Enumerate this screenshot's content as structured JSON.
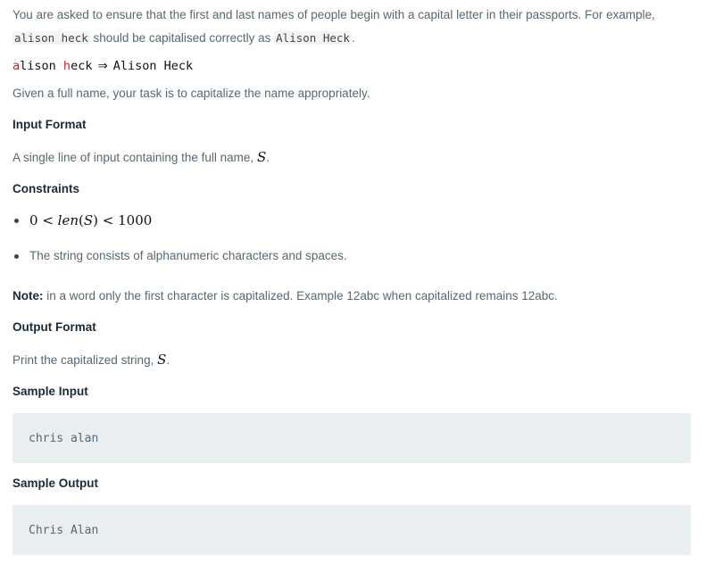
{
  "intro": {
    "part1": "You are asked to ensure that the first and last names of people begin with a capital letter in their passports. For example, ",
    "code1": "alison heck",
    "part2": " should be capitalised correctly as ",
    "code2": "Alison Heck",
    "part3": "."
  },
  "example": {
    "first_letter_1": "a",
    "rest_1": "lison ",
    "first_letter_2": "h",
    "rest_2": "eck",
    "arrow": "⇒",
    "result": "Alison Heck"
  },
  "given": "Given a full name, your task is to capitalize the name appropriately.",
  "input_format": {
    "heading": "Input Format",
    "text": "A single line of input containing the full name, ",
    "var": "S",
    "end": "."
  },
  "constraints": {
    "heading": "Constraints",
    "bullet1": {
      "zero": "0",
      "lt1": " < ",
      "fn": "len",
      "open": "(",
      "var": "S",
      "close": ")",
      "lt2": " < ",
      "max": "1000"
    },
    "bullet2": "The string consists of alphanumeric characters and spaces."
  },
  "note": {
    "label": "Note:",
    "text": " in a word only the first character is capitalized. Example 12abc when capitalized remains 12abc."
  },
  "output_format": {
    "heading": "Output Format",
    "text": "Print the capitalized string, ",
    "var": "S",
    "end": "."
  },
  "sample_input": {
    "heading": "Sample Input",
    "value": "chris alan"
  },
  "sample_output": {
    "heading": "Sample Output",
    "value": "Chris Alan"
  },
  "colors": {
    "highlight_red": "#d21f1f",
    "code_bg": "#e9eef0",
    "body_text": "#576871"
  }
}
